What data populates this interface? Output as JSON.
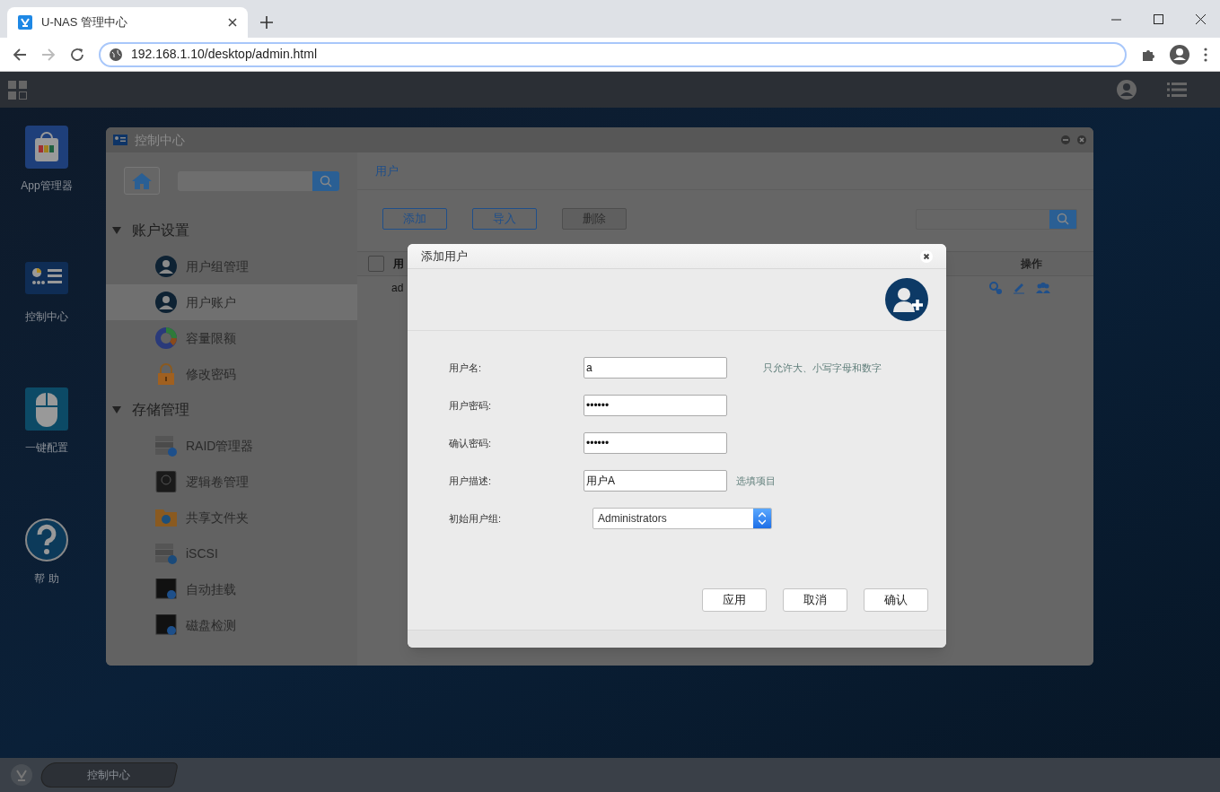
{
  "browser": {
    "tab_title": "U-NAS 管理中心",
    "address": "192.168.1.10/desktop/admin.html"
  },
  "desktop_icons": [
    {
      "kind": "app",
      "label": "App管理器"
    },
    {
      "kind": "control",
      "label": "控制中心"
    },
    {
      "kind": "mouse",
      "label": "一键配置"
    },
    {
      "kind": "help",
      "label": "帮 助"
    }
  ],
  "window": {
    "title": "控制中心",
    "sidebar": [
      {
        "title": "账户设置",
        "expanded": true,
        "items": [
          {
            "kind": "group",
            "label": "用户组管理",
            "selected": false
          },
          {
            "kind": "user",
            "label": "用户账户",
            "selected": true
          },
          {
            "kind": "quota",
            "label": "容量限额",
            "selected": false
          },
          {
            "kind": "lock",
            "label": "修改密码",
            "selected": false
          }
        ]
      },
      {
        "title": "存储管理",
        "expanded": true,
        "items": [
          {
            "kind": "raid",
            "label": "RAID管理器",
            "selected": false
          },
          {
            "kind": "lvm",
            "label": "逻辑卷管理",
            "selected": false
          },
          {
            "kind": "folder",
            "label": "共享文件夹",
            "selected": false
          },
          {
            "kind": "iscsi",
            "label": "iSCSI",
            "selected": false
          },
          {
            "kind": "mount",
            "label": "自动挂载",
            "selected": false
          },
          {
            "kind": "disk",
            "label": "磁盘检测",
            "selected": false
          }
        ]
      }
    ],
    "breadcrumb": "用户",
    "toolbar": [
      {
        "label": "添加",
        "disabled": false
      },
      {
        "label": "导入",
        "disabled": false
      },
      {
        "label": "删除",
        "disabled": true
      }
    ],
    "table": {
      "select_all_checked": false,
      "columns": [
        "用",
        "操作"
      ],
      "rows": [
        {
          "cells": [
            "ad"
          ]
        }
      ]
    }
  },
  "dialog": {
    "title": "添加用户",
    "fields": [
      {
        "kind": "text",
        "label": "用户名:",
        "value": "a",
        "hint": "只允许大、小写字母和数字"
      },
      {
        "kind": "text",
        "label": "用户密码:",
        "value": "••••••"
      },
      {
        "kind": "text",
        "label": "确认密码:",
        "value": "••••••"
      },
      {
        "kind": "text",
        "label": "用户描述:",
        "value": "用户A",
        "hint": "选填项目"
      },
      {
        "kind": "select",
        "label": "初始用户组:",
        "value": "Administrators"
      }
    ],
    "buttons": [
      "应用",
      "取消",
      "确认"
    ]
  },
  "taskbar": {
    "task": "控制中心"
  }
}
